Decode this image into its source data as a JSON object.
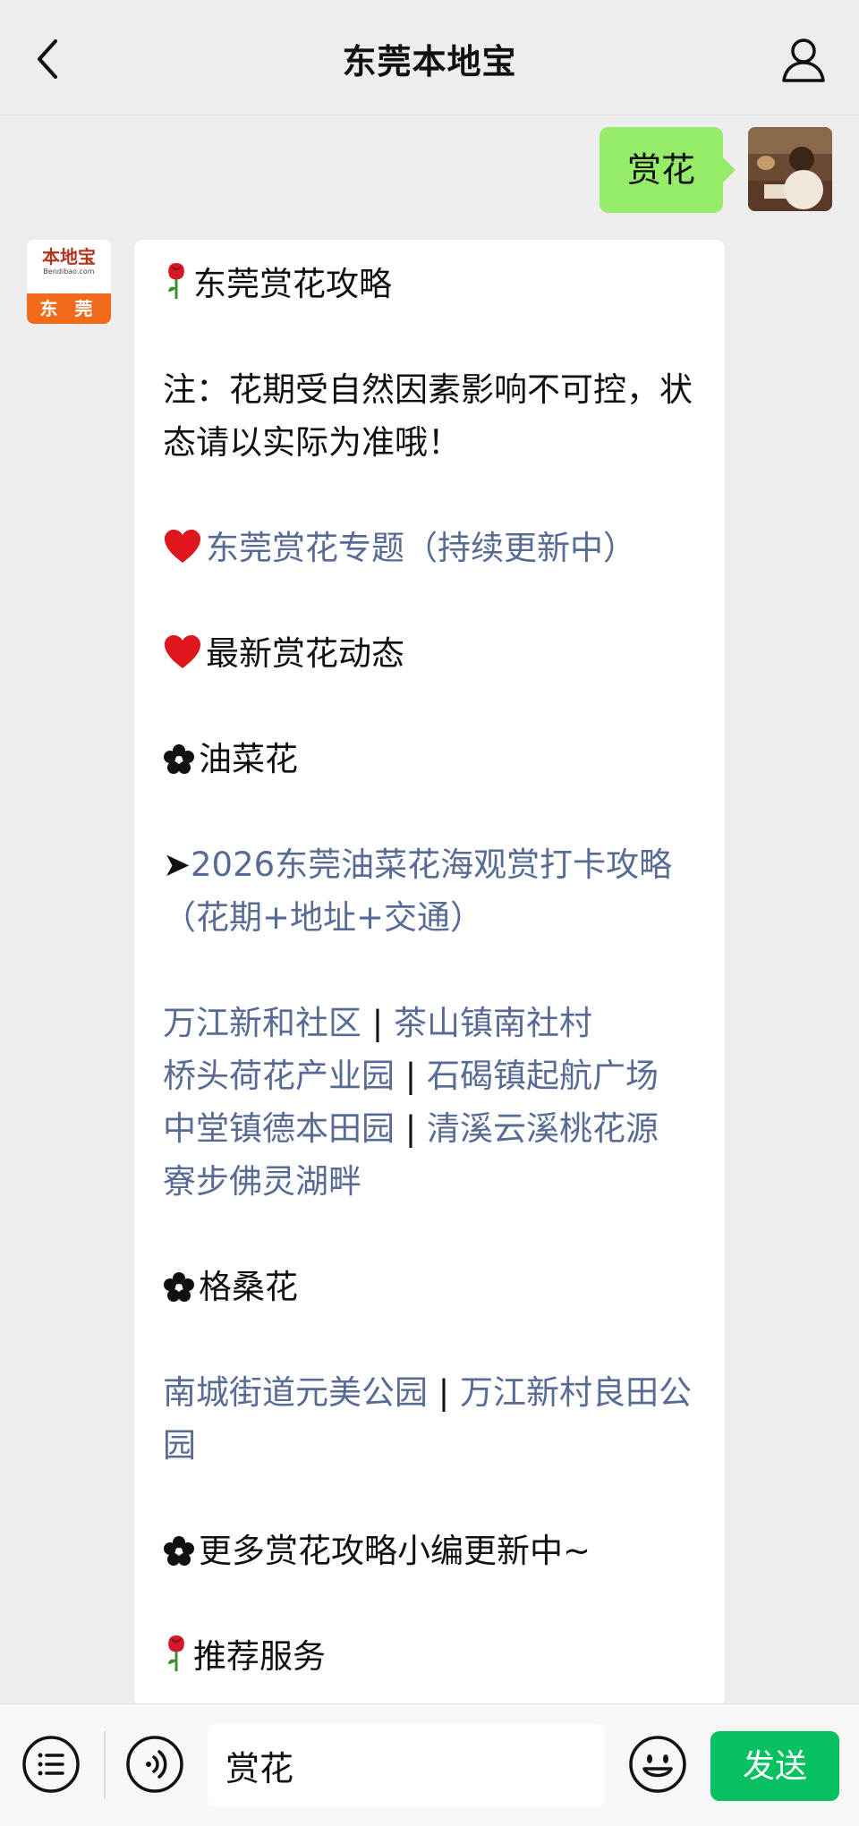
{
  "header": {
    "title": "东莞本地宝",
    "back_icon": "chevron-left-icon",
    "profile_icon": "person-icon"
  },
  "messages": {
    "user": {
      "text": "赏花"
    },
    "bot": {
      "avatar": {
        "logo_cn": "本地宝",
        "logo_en": "Bendibao.com",
        "city": "东 莞"
      },
      "title": "东莞赏花攻略",
      "note": "注：花期受自然因素影响不可控，状态请以实际为准哦！",
      "topic_link": "东莞赏花专题（持续更新中）",
      "latest": "最新赏花动态",
      "section_rapeseed": "油菜花",
      "rapeseed_link_arrow": "➤",
      "rapeseed_link": "2026东莞油菜花海观赏打卡攻略（花期+地址+交通）",
      "rapeseed_places": [
        "万江新和社区",
        "茶山镇南社村",
        "桥头荷花产业园",
        "石碣镇起航广场",
        "中堂镇德本田园",
        "清溪云溪桃花源",
        "寮步佛灵湖畔"
      ],
      "separator": " | ",
      "section_gesang": "格桑花",
      "gesang_places": [
        "南城街道元美公园",
        "万江新村良田公园"
      ],
      "section_more": "更多赏花攻略小编更新中~",
      "recommend": "推荐服务"
    }
  },
  "input_bar": {
    "value": "赏花",
    "send_label": "发送"
  },
  "colors": {
    "background": "#ededed",
    "user_bubble": "#95ec69",
    "link": "#576b95",
    "send_button": "#07c160"
  }
}
